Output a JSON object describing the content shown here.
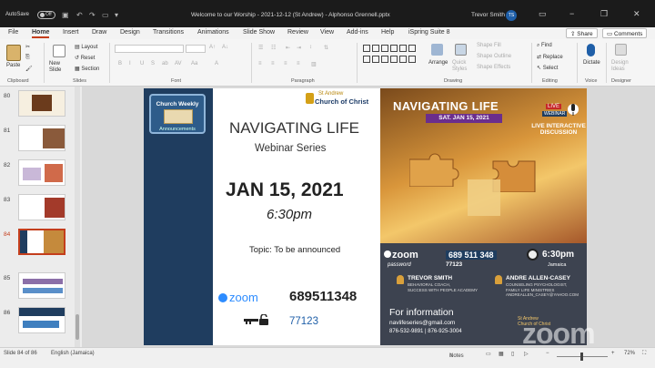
{
  "titlebar": {
    "autosave": "AutoSave",
    "toggle": "Off",
    "document": "Welcome to our Worship - 2021-12-12 (St Andrew) - Alphonso Grennell.pptx",
    "user": "Trevor Smith",
    "initials": "TS",
    "minimize": "−",
    "restore": "❐",
    "close": "✕"
  },
  "tabs": [
    "File",
    "Home",
    "Insert",
    "Draw",
    "Design",
    "Transitions",
    "Animations",
    "Slide Show",
    "Review",
    "View",
    "Add-ins",
    "Help",
    "iSpring Suite 8"
  ],
  "active_tab": "Home",
  "share_label": "Share",
  "comments_label": "Comments",
  "ribbon": {
    "clipboard": {
      "paste": "Paste",
      "group": "Clipboard"
    },
    "slides": {
      "new_slide": "New Slide",
      "layout": "Layout",
      "reset": "Reset",
      "section": "Section",
      "group": "Slides"
    },
    "font": {
      "group": "Font"
    },
    "paragraph": {
      "group": "Paragraph"
    },
    "drawing": {
      "arrange": "Arrange",
      "quick_styles": "Quick Styles",
      "shape_fill": "Shape Fill",
      "shape_outline": "Shape Outline",
      "shape_effects": "Shape Effects",
      "group": "Drawing"
    },
    "editing": {
      "find": "Find",
      "replace": "Replace",
      "select": "Select",
      "group": "Editing"
    },
    "voice": {
      "dictate": "Dictate",
      "group": "Voice"
    },
    "designer": {
      "design_ideas": "Design Ideas",
      "group": "Designer"
    }
  },
  "slides_panel": {
    "items": [
      {
        "num": "80"
      },
      {
        "num": "81"
      },
      {
        "num": "82"
      },
      {
        "num": "83"
      },
      {
        "num": "84"
      },
      {
        "num": "85"
      },
      {
        "num": "86"
      }
    ],
    "selected": "84"
  },
  "slide": {
    "church_weekly": "Church Weekly",
    "announcements": "Announcements",
    "logo_line1": "St Andrew",
    "logo_line2": "Church of Christ",
    "heading": "NAVIGATING LIFE",
    "subheading": "Webinar Series",
    "date": "JAN 15, 2021",
    "time": "6:30pm",
    "topic": "Topic: To be announced",
    "zoom": "zoom",
    "meeting_id": "689511348",
    "passcode": "77123"
  },
  "poster": {
    "title": "NAVIGATING LIFE",
    "date": "SAT. JAN 15, 2021",
    "live": "LIVE",
    "webinar": "WEBINAR",
    "live_discussion": "LIVE INTERACTIVE DISCUSSION",
    "zoom": "zoom",
    "zoom_id": "689 511 348",
    "password_label": "password",
    "password_value": "77123",
    "time": "6:30pm",
    "time_zone": "Jamaica",
    "speaker1_name": "TREVOR SMITH",
    "speaker1_role1": "BEHAVIORAL COACH,",
    "speaker1_role2": "SUCCESS WITH PEOPLE ACADEMY",
    "speaker2_name": "ANDRE ALLEN-CASEY",
    "speaker2_role1": "COUNSELING PSYCHOLOGIST,",
    "speaker2_role2": "FAMILY LIFE MINISTRIES",
    "speaker2_email": "ANDREALLEN_CASEY@YAHOO.COM",
    "info": "For information",
    "email": "navlifeseries@gmail.com",
    "phones": "876-532-9891 | 876-925-3004",
    "logo1": "St Andrew",
    "logo2": "Church of Christ"
  },
  "watermark": "zoom",
  "statusbar": {
    "slide_of": "Slide 84 of 86",
    "language": "English (Jamaica)",
    "notes": "Notes",
    "zoom_pct": "72%"
  },
  "colors": {
    "accent": "#c43e1c",
    "strip_navy": "#1f3d5f",
    "zoom_blue": "#2d8cff"
  }
}
